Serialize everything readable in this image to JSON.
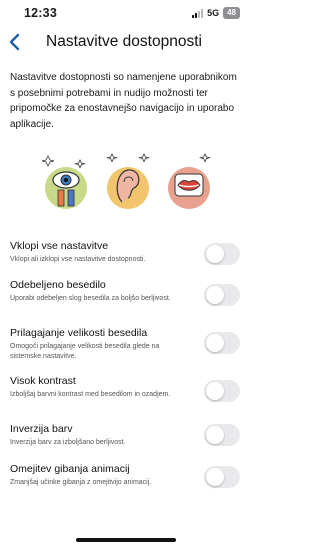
{
  "status": {
    "time": "12:33",
    "network": "5G",
    "battery": "48"
  },
  "header": {
    "title": "Nastavitve dostopnosti",
    "back_icon": "chevron-left-icon"
  },
  "intro": "Nastavitve dostopnosti so namenjene uporabnikom s posebnimi potrebami in nudijo možnosti ter pripomočke za enostavnejšo navigacijo in uporabo aplikacije.",
  "illustrations": [
    {
      "name": "eye-illustration",
      "color": "#c9d98a"
    },
    {
      "name": "ear-illustration",
      "color": "#f2c46b"
    },
    {
      "name": "mouth-illustration",
      "color": "#e8a08f"
    }
  ],
  "settings": [
    {
      "label": "Vklopi vse nastavitve",
      "desc": "Vklopi ali izklopi vse nastavitve dostopnosti.",
      "enabled": false
    },
    {
      "label": "Odebeljeno besedilo",
      "desc": "Uporabi odebeljen slog besedila za boljšo berljivost.",
      "enabled": false
    },
    {
      "label": "Prilagajanje velikosti besedila",
      "desc": "Omogoči prilagajanje velikosti besedila glede na sistemske nastavitve.",
      "enabled": false
    },
    {
      "label": "Visok kontrast",
      "desc": "Izboljšaj barvni kontrast med besedilom in ozadjem.",
      "enabled": false
    },
    {
      "label": "Inverzija barv",
      "desc": "Inverzija barv za izboljšano berljivost.",
      "enabled": false
    },
    {
      "label": "Omejitev gibanja animacij",
      "desc": "Zmanjšaj učinke gibanja z omejitvijo animacij.",
      "enabled": false
    }
  ],
  "colors": {
    "accent": "#1f5fa8",
    "toggle_off": "#e9e9eb"
  }
}
